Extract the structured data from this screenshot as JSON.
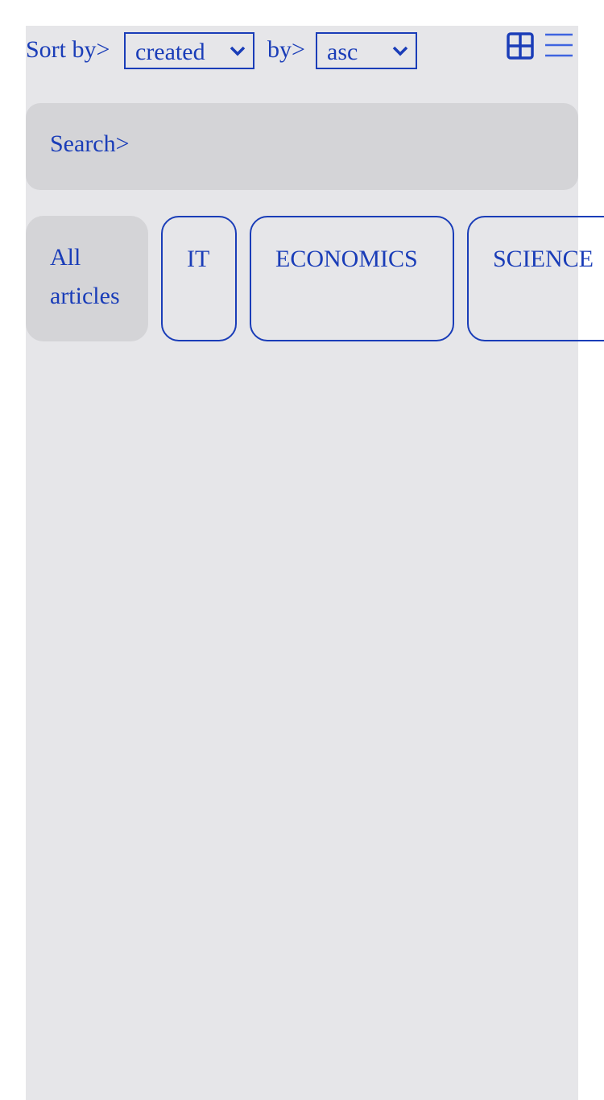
{
  "sort": {
    "label": "Sort by>",
    "field_value": "created",
    "order_label": "by>",
    "order_value": "asc"
  },
  "view_toggle": {
    "grid_icon": "grid-view-icon",
    "list_icon": "list-view-icon"
  },
  "search": {
    "placeholder": "Search>"
  },
  "categories": [
    {
      "label": "All articles",
      "active": true
    },
    {
      "label": "IT",
      "active": false
    },
    {
      "label": "ECONOMICS",
      "active": false
    },
    {
      "label": "SCIENCE",
      "active": false
    }
  ],
  "colors": {
    "accent": "#1a3db8",
    "panel": "#e6e6e9",
    "field": "#d4d4d7"
  }
}
